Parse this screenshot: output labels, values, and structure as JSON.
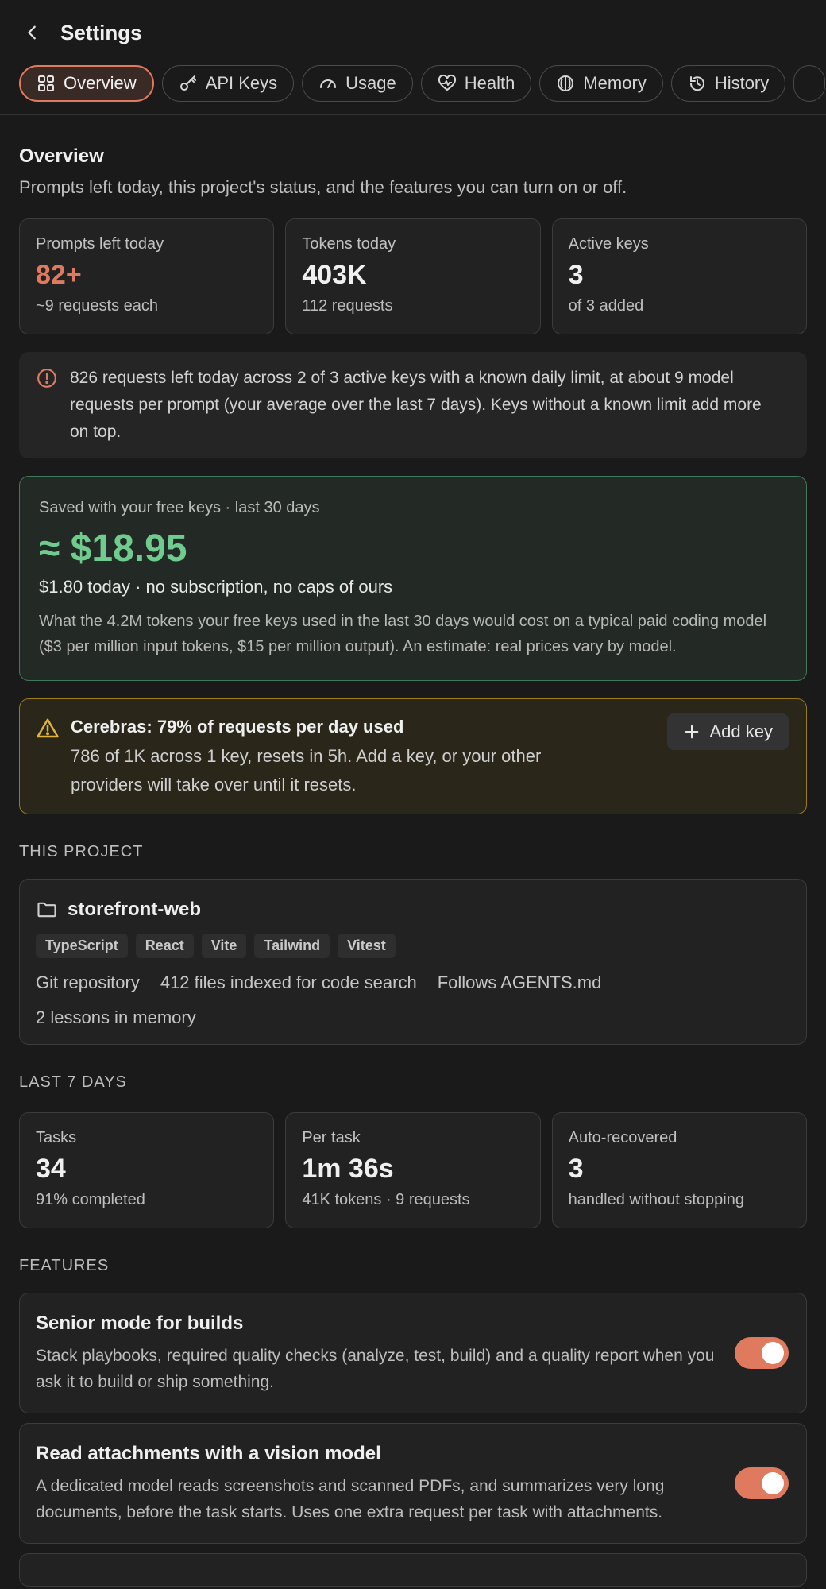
{
  "header": {
    "title": "Settings",
    "back_icon": "chevron-left-icon"
  },
  "tabs": [
    {
      "label": "Overview",
      "icon": "grid-icon",
      "active": true
    },
    {
      "label": "API Keys",
      "icon": "key-icon"
    },
    {
      "label": "Usage",
      "icon": "gauge-icon"
    },
    {
      "label": "Health",
      "icon": "heart-pulse-icon"
    },
    {
      "label": "Memory",
      "icon": "brain-icon"
    },
    {
      "label": "History",
      "icon": "history-icon"
    }
  ],
  "overview": {
    "title": "Overview",
    "subtitle": "Prompts left today, this project's status, and the features you can turn on or off.",
    "stats": [
      {
        "label": "Prompts left today",
        "value": "82+",
        "sub": "~9 requests each"
      },
      {
        "label": "Tokens today",
        "value": "403K",
        "sub": "112 requests"
      },
      {
        "label": "Active keys",
        "value": "3",
        "sub": "of 3 added"
      }
    ],
    "info": "826 requests left today across 2 of 3 active keys with a known daily limit, at about 9 model requests per prompt (your average over the last 7 days). Keys without a known limit add more on top."
  },
  "savings": {
    "caption": "Saved with your free keys · last 30 days",
    "amount": "≈ $18.95",
    "today": "$1.80 today · no subscription, no caps of ours",
    "description": "What the 4.2M tokens your free keys used in the last 30 days would cost on a typical paid coding model ($3 per million input tokens, $15 per million output). An estimate: real prices vary by model."
  },
  "warning": {
    "title": "Cerebras: 79% of requests per day used",
    "body": "786 of 1K across 1 key, resets in 5h. Add a key, or your other providers will take over until it resets.",
    "button": "Add key"
  },
  "project": {
    "section": "THIS PROJECT",
    "name": "storefront-web",
    "tags": [
      "TypeScript",
      "React",
      "Vite",
      "Tailwind",
      "Vitest"
    ],
    "facts": [
      "Git repository",
      "412 files indexed for code search",
      "Follows AGENTS.md"
    ],
    "lessons": "2 lessons in memory"
  },
  "last7": {
    "section": "LAST 7 DAYS",
    "stats": [
      {
        "label": "Tasks",
        "value": "34",
        "sub": "91% completed"
      },
      {
        "label": "Per task",
        "value": "1m 36s",
        "sub": "41K tokens · 9 requests"
      },
      {
        "label": "Auto-recovered",
        "value": "3",
        "sub": "handled without stopping"
      }
    ]
  },
  "features": {
    "section": "FEATURES",
    "items": [
      {
        "title": "Senior mode for builds",
        "description": "Stack playbooks, required quality checks (analyze, test, build) and a quality report when you ask it to build or ship something.",
        "enabled": true
      },
      {
        "title": "Read attachments with a vision model",
        "description": "A dedicated model reads screenshots and scanned PDFs, and summarizes very long documents, before the task starts. Uses one extra request per task with attachments.",
        "enabled": true
      }
    ]
  },
  "colors": {
    "accent": "#e07a5f",
    "success": "#6fcb8e",
    "warning": "#e0b43a",
    "background": "#1a1a1a"
  }
}
